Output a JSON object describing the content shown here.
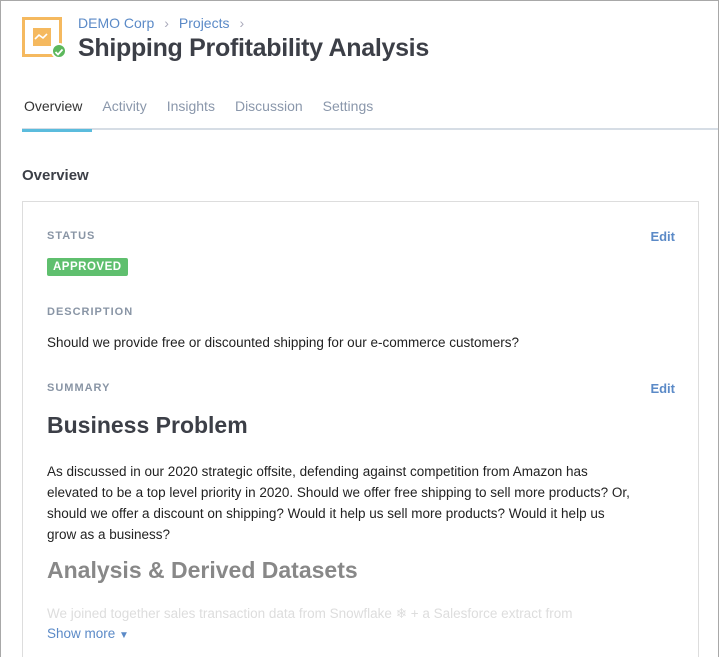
{
  "breadcrumb": [
    "DEMO Corp",
    "Projects"
  ],
  "title": "Shipping Profitability Analysis",
  "tabs": [
    "Overview",
    "Activity",
    "Insights",
    "Discussion",
    "Settings"
  ],
  "section_title": "Overview",
  "status": {
    "label": "STATUS",
    "edit": "Edit",
    "badge": "APPROVED",
    "badge_color": "#5fbf6e"
  },
  "description": {
    "label": "DESCRIPTION",
    "text": "Should we provide free or discounted shipping for our e-commerce customers?"
  },
  "summary": {
    "label": "SUMMARY",
    "edit": "Edit",
    "heading1": "Business Problem",
    "paragraph": "As discussed in our 2020 strategic offsite, defending against competition from Amazon has elevated to be a top level priority in 2020. Should we offer free shipping to sell more products? Or, should we offer a discount on shipping? Would it help us sell more products? Would it help us grow as a business?",
    "heading2": "Analysis & Derived Datasets",
    "faded_text": "We joined together sales transaction data from Snowflake ❄ + a Salesforce extract from",
    "show_more": "Show more"
  }
}
